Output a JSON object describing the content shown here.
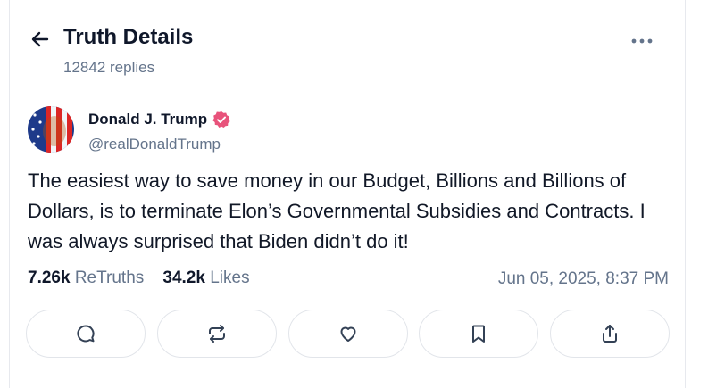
{
  "header": {
    "title": "Truth Details",
    "replies": "12842 replies"
  },
  "post": {
    "author_name": "Donald J. Trump",
    "handle": "@realDonaldTrump",
    "verified": true,
    "text": "The easiest way to save money in our Budget, Billions and Billions of Dollars, is to terminate Elon’s Governmental Subsidies and Contracts. I was always surprised that Biden didn’t do it!",
    "retruths_count": "7.26k",
    "retruths_label": "ReTruths",
    "likes_count": "34.2k",
    "likes_label": "Likes",
    "timestamp": "Jun 05, 2025, 8:37 PM"
  },
  "actions": [
    "reply-icon",
    "retruth-icon",
    "heart-icon",
    "bookmark-icon",
    "share-icon"
  ],
  "colors": {
    "verified": "#e8537b",
    "muted": "#64748b",
    "text": "#0f172a",
    "border": "#e2e5ea"
  }
}
